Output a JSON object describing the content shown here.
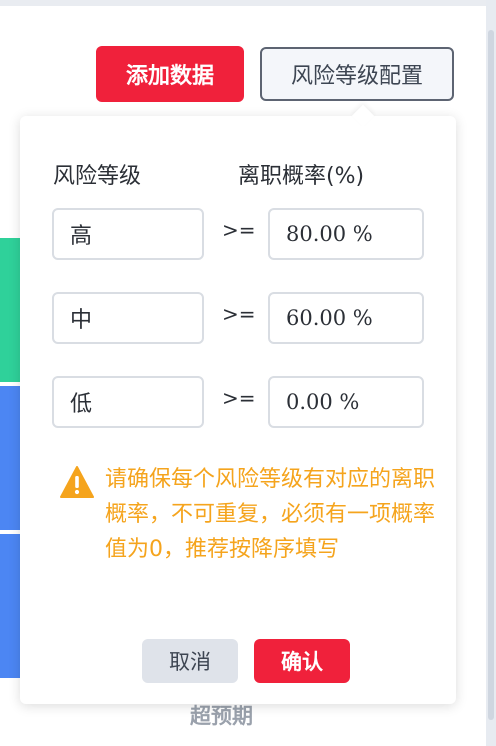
{
  "toolbar": {
    "add_label": "添加数据",
    "config_label": "风险等级配置"
  },
  "background": {
    "footer_text": "超预期"
  },
  "popover": {
    "header_level": "风险等级",
    "header_prob": "离职概率(%)",
    "operator": ">=",
    "rows": [
      {
        "level": "高",
        "value": "80.00 %"
      },
      {
        "level": "中",
        "value": "60.00 %"
      },
      {
        "level": "低",
        "value": "0.00 %"
      }
    ],
    "warning_text": "请确保每个风险等级有对应的离职概率，不可重复，必须有一项概率值为0，推荐按降序填写",
    "cancel_label": "取消",
    "confirm_label": "确认"
  },
  "colors": {
    "primary": "#f0213b",
    "warning": "#f5a41d",
    "green": "#2fd19a",
    "blue": "#4c86f3"
  }
}
